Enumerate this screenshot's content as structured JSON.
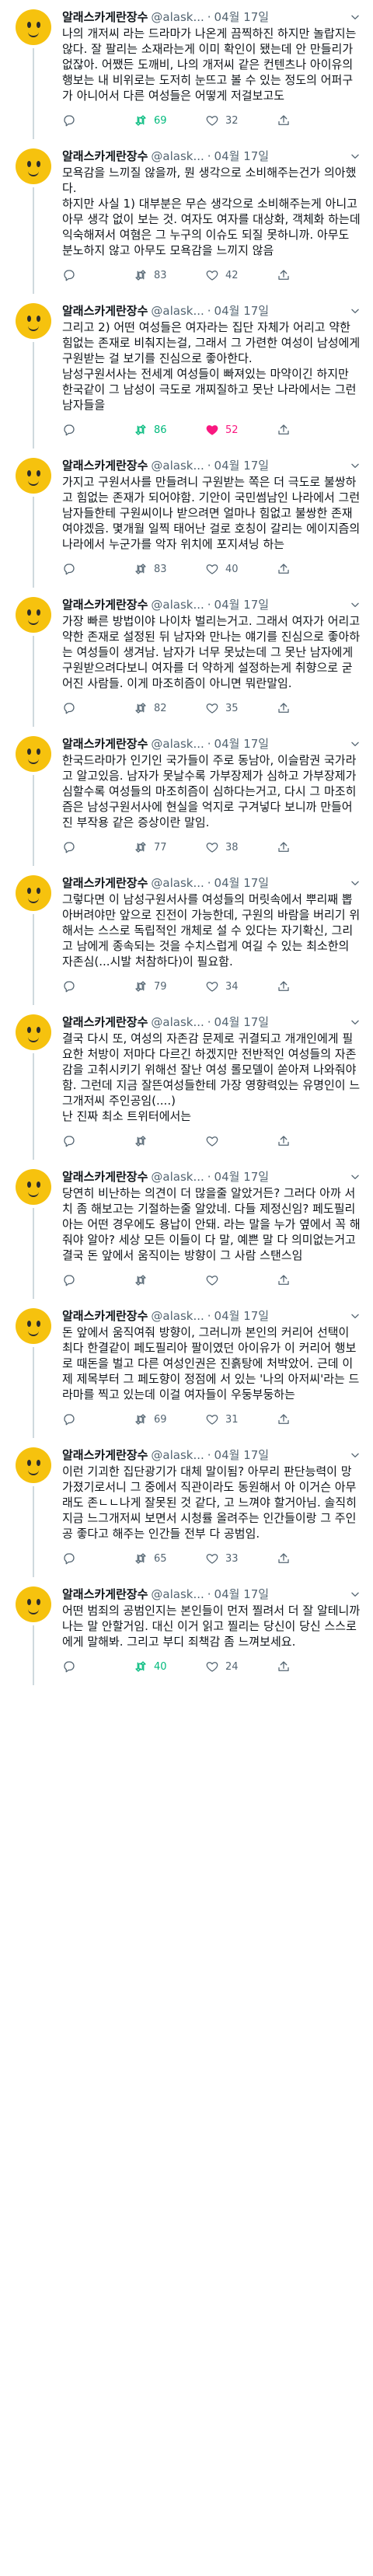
{
  "author": {
    "name": "알래스카게란장수",
    "handle": "@alask...",
    "time_sep": "·"
  },
  "colors": {
    "retweet_active": "#00ba7c",
    "like_active": "#f91880",
    "muted": "#536471"
  },
  "tweets": [
    {
      "time": "04월 17일",
      "text": "나의 개저씨 라는 드라마가 나온게 끔찍하진 하지만 놀랍지는 않다. 잘 팔리는 소재라는게 이미 확인이 됐는데 안 만들리가 없잖아. 어쨌든 도깨비, 나의 개저씨 같은 컨텐츠나 아이유의 행보는 내 비위로는 도저히 눈뜨고 볼 수 있는 정도의 어퍼구가 아니어서 다른 여성들은 어떻게 저걸보고도",
      "replies": "",
      "retweets": "69",
      "likes": "32",
      "retweet_active": true,
      "like_active": false
    },
    {
      "time": "04월 17일",
      "text": "모욕감을 느끼질 않을까, 뭔 생각으로 소비해주는건가 의아했다.\n하지만 사실 1) 대부분은 무슨 생각으로 소비해주는게 아니고 아무 생각 없이 보는 것. 여자도 여자를 대상화, 객체화 하는데 익숙해져서 여혐은 그 누구의 이슈도 되질 못하니까. 아무도 분노하지 않고 아무도 모욕감을 느끼지 않음",
      "replies": "",
      "retweets": "83",
      "likes": "42",
      "retweet_active": false,
      "like_active": false
    },
    {
      "time": "04월 17일",
      "text": "그리고 2) 어떤 여성들은 여자라는 집단 자체가 어리고 약한 힘없는 존재로 비춰지는걸, 그래서 그 가련한 여성이 남성에게 구원받는 걸 보기를 진심으로 좋아한다.\n남성구원서사는 전세계 여성들이 빠져있는 마약이긴 하지만 한국같이 그 남성이 극도로 개찌질하고 못난 나라에서는 그런 남자들을",
      "replies": "",
      "retweets": "86",
      "likes": "52",
      "retweet_active": true,
      "like_active": true
    },
    {
      "time": "04월 17일",
      "text": "가지고 구원서사를 만들려니 구원받는 쪽은 더 극도로 불쌍하고 힘없는 존재가 되어야함. 기안이 국민썸남인 나라에서 그런 남자들한테 구원씨이나 받으려면 얼마나 힘없고 불쌍한 존재여야겠음. 몇개월 일찍 태어난 걸로 호칭이 갈리는 에이지즘의 나라에서 누군가를 악자 위치에 포지셔닝 하는",
      "replies": "",
      "retweets": "83",
      "likes": "40",
      "retweet_active": false,
      "like_active": false
    },
    {
      "time": "04월 17일",
      "text": "가장 빠른 방법이야 나이차 벌리는거고. 그래서 여자가 어리고 약한 존재로 설정된 뒤 남자와 만나는 얘기를 진심으로 좋아하는 여성들이 생겨남. 남자가 너무 못났는데 그 못난 남자에게 구원받으려다보니 여자를 더 약하게 설정하는게 취향으로 굳어진 사람들. 이게 마조히즘이 아니면 뭐란말임.",
      "replies": "",
      "retweets": "82",
      "likes": "35",
      "retweet_active": false,
      "like_active": false
    },
    {
      "time": "04월 17일",
      "text": "한국드라마가 인기인 국가들이 주로 동남아, 이슬람권 국가라고 알고있음. 남자가 못날수록 가부장제가 심하고 가부장제가 심할수록 여성들의 마조히즘이 심하다는거고, 다시 그 마조히즘은 남성구원서사에 현실을 억지로 구겨넣다 보니까 만들어진 부작용 같은 증상이란 말임.",
      "replies": "",
      "retweets": "77",
      "likes": "38",
      "retweet_active": false,
      "like_active": false
    },
    {
      "time": "04월 17일",
      "text": "그렇다면 이 남성구원서사를 여성들의 머릿속에서 뿌리째 뽑아버려야만 앞으로 진전이 가능한데, 구원의 바람을 버리기 위해서는 스스로 독립적인 개체로 설 수 있다는 자기확신, 그리고 남에게 종속되는 것을 수치스럽게 여길 수 있는 최소한의 자존심(...시발 처참하다)이 필요함.",
      "replies": "",
      "retweets": "79",
      "likes": "34",
      "retweet_active": false,
      "like_active": false
    },
    {
      "time": "04월 17일",
      "text": "결국 다시 또, 여성의 자존감 문제로 귀결되고 개개인에게 필요한 처방이 저마다 다르긴 하겠지만 전반적인 여성들의 자존감을 고취시키기 위해선 잘난 여성 롤모델이 쏟아져 나와줘야함. 그런데 지금 잘뜬여성들한테 가장 영향력있는 유명인이 느그개저씨 주인공임(....)\n난 진짜 최소 트위터에서는",
      "replies": "",
      "retweets": "",
      "likes": "",
      "retweet_active": false,
      "like_active": false
    },
    {
      "time": "04월 17일",
      "text": "당연히 비난하는 의견이 더 많을줄 알았거든? 그러다 아까 서치 좀 해보고는 기절하는줄 알았네. 다들 제정신임? 페도필리아는 어떤 경우에도 용납이 안돼. 라는 말을 누가 옆에서 꼭 해줘야 알아? 세상 모든 이들이 다 말, 예쁜 말 다 의미없는거고 결국 돈 앞에서 움직이는 방향이 그 사람 스탠스임",
      "replies": "",
      "retweets": "",
      "likes": "",
      "retweet_active": false,
      "like_active": false
    },
    {
      "time": "04월 17일",
      "text": "돈 앞에서 움직여줘 방향이, 그러니까 본인의 커리어 선택이 최다 한결같이 페도필리아 팔이였던 아이유가 이 커리어 행보로 때돈을 벌고 다른 여성인권은 진흙탕에 처박았어. 근데 이제 제목부터 그 페도향이 정점에 서 있는 '나의 아저씨'라는 드라마를 찍고 있는데 이걸 여자들이 우둥부둥하는",
      "replies": "",
      "retweets": "69",
      "likes": "31",
      "retweet_active": false,
      "like_active": false
    },
    {
      "time": "04월 17일",
      "text": "이런 기괴한 집단광기가 대체 말이됨? 아무리 판단능력이 망가졌기로서니 그 중에서 직관이라도 동원해서 아 이거슨 아무래도 존ㄴㄴ나게 잘못된 것 같다, 고 느껴야 할거아님. 솔직히 지금 느그개저씨 보면서 시청률 올려주는 인간들이랑 그 주인공 좋다고 해주는 인간들 전부 다 공범임.",
      "replies": "",
      "retweets": "65",
      "likes": "33",
      "retweet_active": false,
      "like_active": false
    },
    {
      "time": "04월 17일",
      "text": "어떤 범죄의 공범인지는 본인들이 먼저 찔려서 더 잘 알테니까 나는 말 안할거임. 대신 이거 읽고 찔리는 당신이 당신 스스로에게 말해봐. 그리고 부디 죄책감 좀 느껴보세요.",
      "replies": "",
      "retweets": "40",
      "likes": "24",
      "retweet_active": true,
      "like_active": false
    }
  ]
}
